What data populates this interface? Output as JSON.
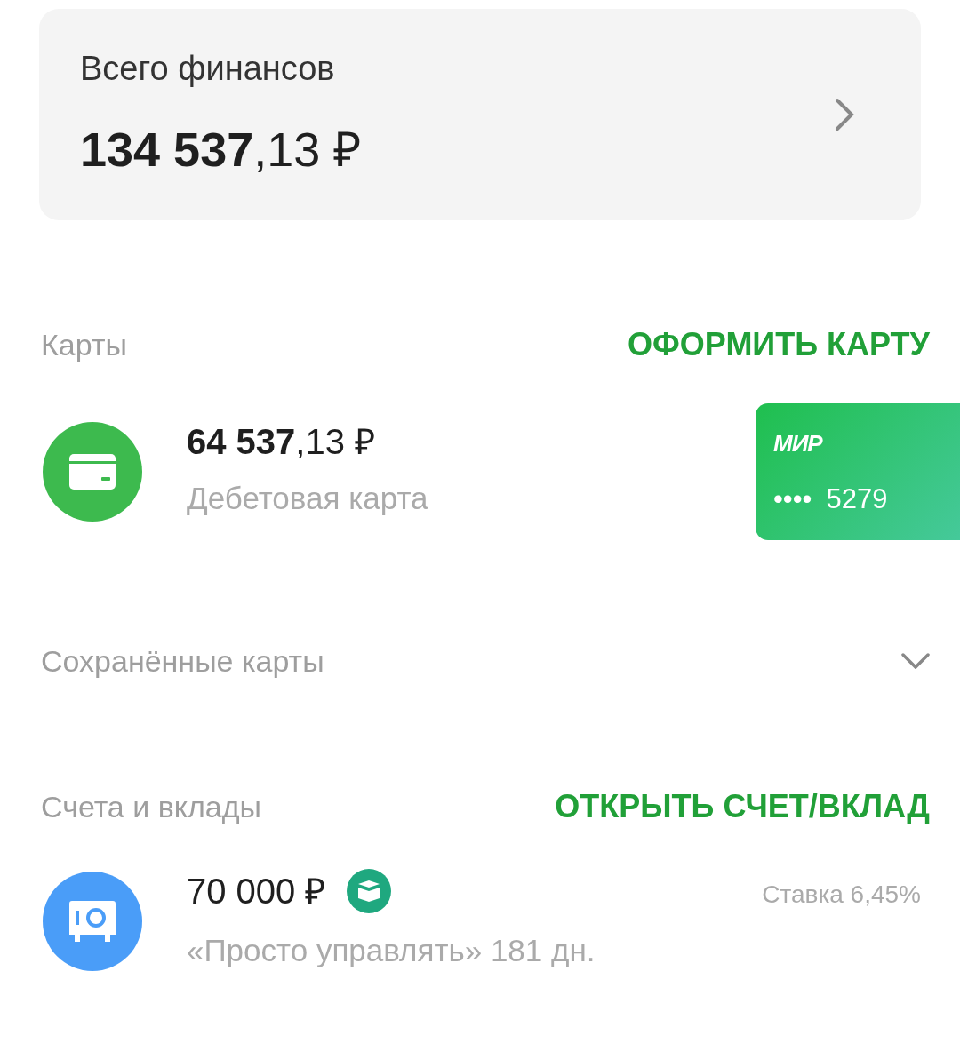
{
  "summary": {
    "title": "Всего финансов",
    "amount": "**134 537**,13 ₽"
  },
  "cards_section": {
    "title": "Карты",
    "action": "ОФОРМИТЬ КАРТУ",
    "items": [
      {
        "amount": "**64 537**,13 ₽",
        "subtitle": "Дебетовая карта",
        "card": {
          "brand": "МИР",
          "mask": "••••",
          "last4": "5279"
        }
      }
    ]
  },
  "saved_cards": {
    "title": "Сохранённые карты",
    "expanded": false
  },
  "accounts_section": {
    "title": "Счета и вклады",
    "action": "ОТКРЫТЬ СЧЕТ/ВКЛАД",
    "items": [
      {
        "amount": "70 000 ₽",
        "subtitle": "«Просто управлять» 181 дн.",
        "rate": "Ставка 6,45%"
      }
    ]
  }
}
